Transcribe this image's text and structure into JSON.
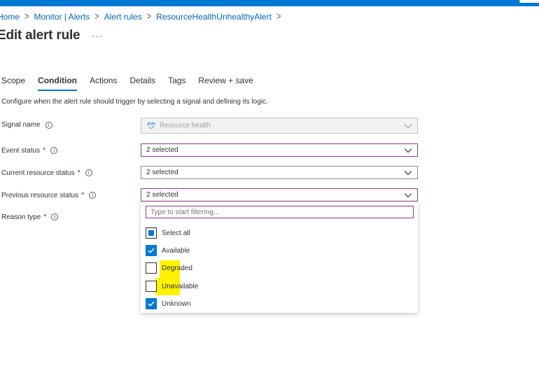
{
  "breadcrumb": {
    "items": [
      "Home",
      "Monitor | Alerts",
      "Alert rules",
      "ResourceHealthUnhealthyAlert"
    ],
    "separator": ">"
  },
  "page": {
    "title": "Edit alert rule",
    "more": "···"
  },
  "tabs": [
    {
      "label": "Scope",
      "active": false
    },
    {
      "label": "Condition",
      "active": true
    },
    {
      "label": "Actions",
      "active": false
    },
    {
      "label": "Details",
      "active": false
    },
    {
      "label": "Tags",
      "active": false
    },
    {
      "label": "Review + save",
      "active": false
    }
  ],
  "description": "Configure when the alert rule should trigger by selecting a signal and defining its logic.",
  "form": {
    "signal_name": {
      "label": "Signal name",
      "value": "Resource health",
      "icon": "heartbeat-icon"
    },
    "event_status": {
      "label": "Event status",
      "value": "2 selected",
      "required": "*"
    },
    "current_resource_status": {
      "label": "Current resource status",
      "value": "2 selected",
      "required": "*"
    },
    "previous_resource_status": {
      "label": "Previous resource status",
      "value": "2 selected",
      "required": "*"
    },
    "reason_type": {
      "label": "Reason type",
      "required": "*"
    }
  },
  "dropdown_panel": {
    "filter_placeholder": "Type to start filtering...",
    "options": [
      {
        "label": "Select all",
        "state": "indeterminate"
      },
      {
        "label": "Available",
        "state": "checked"
      },
      {
        "label": "Degraded",
        "state": "unchecked"
      },
      {
        "label": "Unavailable",
        "state": "unchecked"
      },
      {
        "label": "Unknown",
        "state": "checked"
      }
    ]
  },
  "colors": {
    "accent": "#0078d4",
    "focus_border": "#8a3a8e",
    "required": "#a4262c",
    "highlight": "#fff200",
    "link": "#0066b8"
  }
}
